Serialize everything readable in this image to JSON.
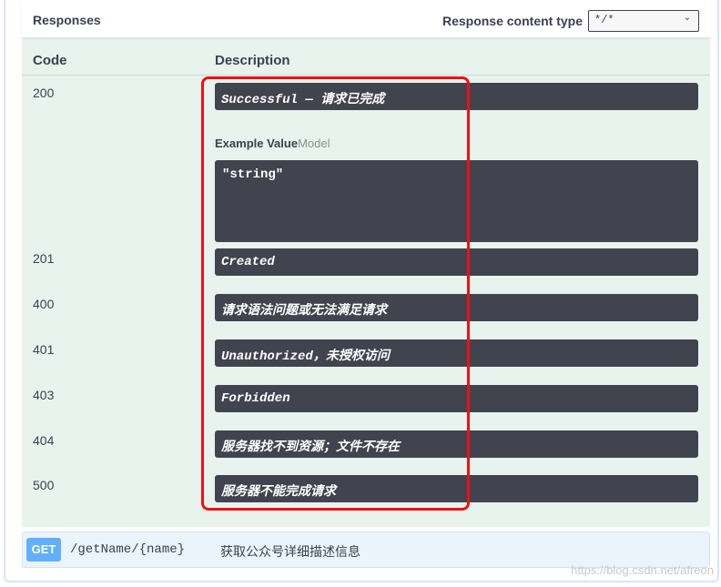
{
  "responses_header": {
    "title": "Responses",
    "content_type_label": "Response content type",
    "content_type_value": "*/*"
  },
  "columns": {
    "code": "Code",
    "description": "Description"
  },
  "responses": [
    {
      "code": "200",
      "description": "Successful — 请求已完成"
    },
    {
      "code": "201",
      "description": "Created"
    },
    {
      "code": "400",
      "description": "请求语法问题或无法满足请求"
    },
    {
      "code": "401",
      "description": "Unauthorized，未授权访问"
    },
    {
      "code": "403",
      "description": "Forbidden"
    },
    {
      "code": "404",
      "description": "服务器找不到资源；文件不存在"
    },
    {
      "code": "500",
      "description": "服务器不能完成请求"
    }
  ],
  "example": {
    "example_value_label": "Example Value",
    "model_label": "Model",
    "value": "\"string\""
  },
  "next_operation": {
    "method": "GET",
    "path": "/getName/{name}",
    "summary": "获取公众号详细描述信息"
  },
  "watermark": "https://blog.csdn.net/afreon",
  "colors": {
    "method_get": "#61affe",
    "highlight": "#ee1111",
    "description_bg": "#41444e",
    "panel_bg": "#e8f3ee"
  }
}
